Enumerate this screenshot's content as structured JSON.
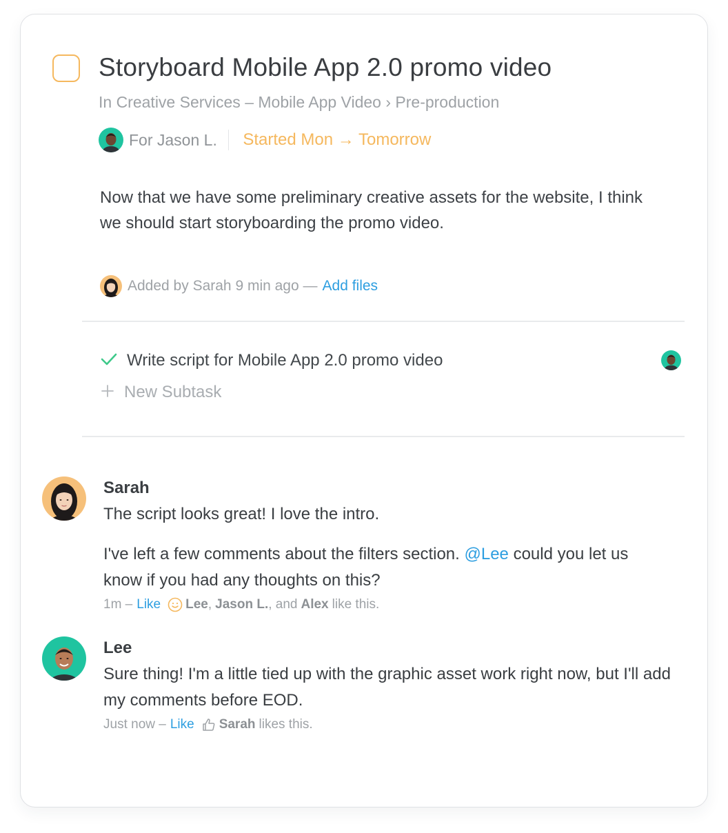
{
  "task": {
    "title": "Storyboard Mobile App 2.0 promo video",
    "breadcrumb": "In Creative Services – Mobile App Video › Pre-production",
    "assignee_label": "For Jason L.",
    "dates": "Started Mon → Tomorrow",
    "description": "Now that we have some preliminary creative assets for the website, I think we should start storyboarding the promo video.",
    "added_by": "Added by Sarah 9 min ago —",
    "add_files_label": "Add files"
  },
  "subtasks": {
    "completed": [
      {
        "label": "Write script for Mobile App 2.0 promo video"
      }
    ],
    "new_subtask_label": "New Subtask"
  },
  "comments": [
    {
      "author": "Sarah",
      "paragraph1": "The script looks great! I love the intro.",
      "paragraph2_before": "I've left a few comments about the filters section.",
      "mention": "@Lee",
      "paragraph2_after": "could you let us know if you had any thoughts on this?",
      "time": "1m –",
      "like_label": "Like",
      "likers": {
        "name1": "Lee",
        "sep1": ",",
        "name2": "Jason L.",
        "sep2": ", and",
        "name3": "Alex",
        "suffix": "like this."
      }
    },
    {
      "author": "Lee",
      "text": "Sure thing! I'm a little tied up with the graphic asset work right now, but I'll add my comments before EOD.",
      "time": "Just now –",
      "like_label": "Like",
      "likers": {
        "name1": "Sarah",
        "suffix": "likes this."
      }
    }
  ],
  "colors": {
    "accent_orange": "#f5b85e",
    "link_blue": "#2d9ee0",
    "check_green": "#3ec98a",
    "avatar_teal": "#1fc4a0",
    "avatar_peach": "#f6c07a"
  },
  "icons": {
    "checkbox": "checkbox-icon",
    "check": "checkmark-icon",
    "plus": "plus-icon",
    "smile": "smiley-icon",
    "thumb": "thumbs-up-icon"
  }
}
